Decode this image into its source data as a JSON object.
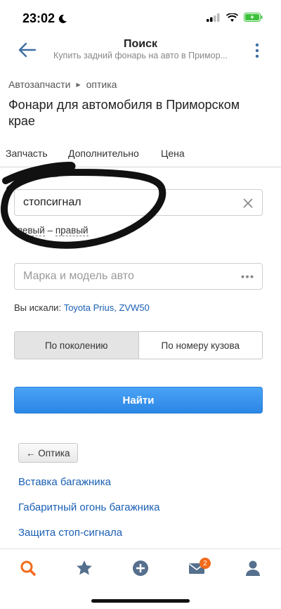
{
  "status": {
    "time": "23:02",
    "battery_color": "#3cc13b"
  },
  "nav": {
    "title": "Поиск",
    "subtitle": "Купить задний фонарь на авто в Примор..."
  },
  "breadcrumb": {
    "item1": "Автозапчасти",
    "item2": "оптика"
  },
  "page_title": "Фонари для автомобиля в Приморском крае",
  "tabs": [
    "Запчасть",
    "Дополнительно",
    "Цена"
  ],
  "part_input": {
    "value": "стопсигнал"
  },
  "sides": {
    "left": "левый",
    "dash": "–",
    "right": "правый"
  },
  "model_input": {
    "placeholder": "Марка и модель авто"
  },
  "searched": {
    "label": "Вы искали:",
    "value": "Toyota Prius, ZVW50"
  },
  "segment": {
    "option1": "По поколению",
    "option2": "По номеру кузова"
  },
  "find_button": "Найти",
  "back_chip": "← Оптика",
  "links": [
    "Вставка багажника",
    "Габаритный огонь багажника",
    "Защита стоп-сигнала"
  ],
  "tabbar": {
    "items": [
      "search-icon",
      "star-icon",
      "plus-circle-icon",
      "mail-icon",
      "user-icon"
    ],
    "mail_badge": "2",
    "active_color": "#f26a1b",
    "inactive_color": "#55708d"
  }
}
